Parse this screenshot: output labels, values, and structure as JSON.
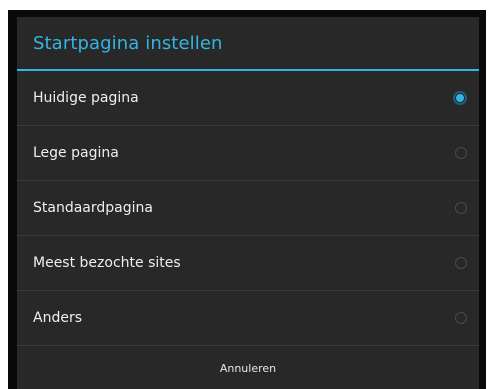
{
  "dialog": {
    "title": "Startpagina instellen",
    "options": [
      {
        "label": "Huidige pagina",
        "selected": true
      },
      {
        "label": "Lege pagina",
        "selected": false
      },
      {
        "label": "Standaardpagina",
        "selected": false
      },
      {
        "label": "Meest bezochte sites",
        "selected": false
      },
      {
        "label": "Anders",
        "selected": false
      }
    ],
    "cancel_label": "Annuleren"
  },
  "colors": {
    "accent": "#33b5e5",
    "dialog_background": "#282828",
    "text": "#efefef"
  }
}
